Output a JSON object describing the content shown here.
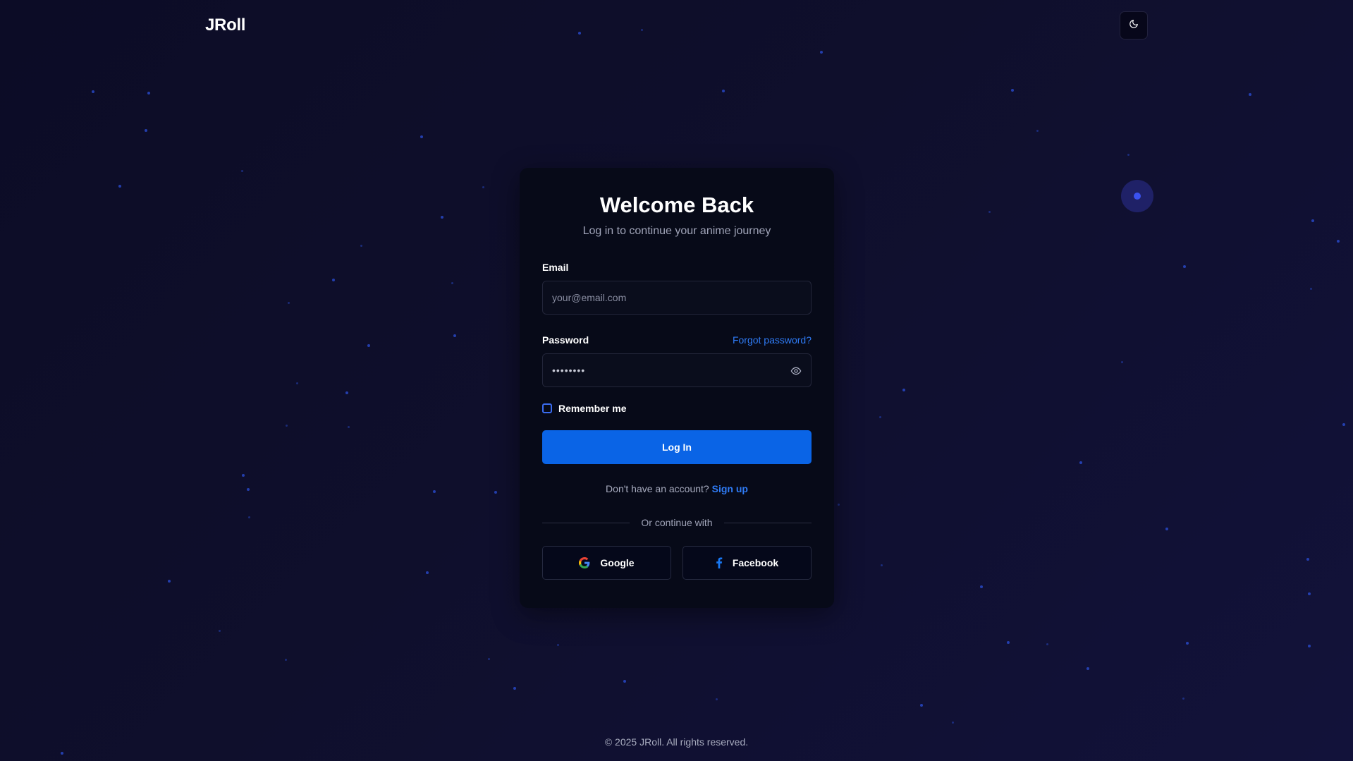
{
  "header": {
    "logo_text": "JRoll",
    "theme_toggle_icon": "moon-icon"
  },
  "login_card": {
    "title": "Welcome Back",
    "subtitle": "Log in to continue your anime journey",
    "email": {
      "label": "Email",
      "placeholder": "your@email.com",
      "value": ""
    },
    "password": {
      "label": "Password",
      "value": "••••••••",
      "forgot_link": "Forgot password?",
      "toggle_icon": "eye-icon"
    },
    "remember_me": {
      "label": "Remember me",
      "checked": false
    },
    "login_button": "Log In",
    "signup_prompt": "Don't have an account?",
    "signup_link": "Sign up",
    "divider_text": "Or continue with",
    "social": {
      "google_label": "Google",
      "google_icon": "google-icon",
      "facebook_label": "Facebook",
      "facebook_icon": "facebook-icon"
    }
  },
  "footer": {
    "copyright": "© 2025 JRoll. All rights reserved."
  },
  "colors": {
    "background": "#0f0f2c",
    "card": "#070a18",
    "accent": "#0a64e6",
    "link": "#2f7bf5",
    "star": "#2b4fd8"
  }
}
